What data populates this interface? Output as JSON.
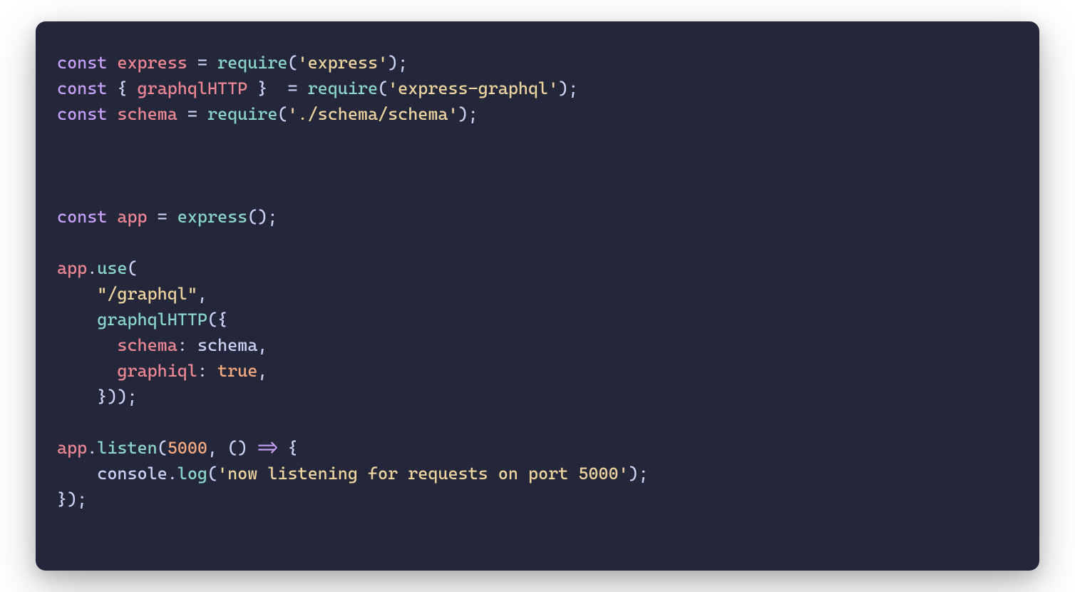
{
  "code": {
    "t1": "const",
    "t2": "express",
    "t3": "require",
    "t4": "'express'",
    "t5": "const",
    "t6": "graphqlHTTP",
    "t7": "require",
    "t8": "'express-graphql'",
    "t9": "const",
    "t10": "schema",
    "t11": "require",
    "t12": "'./schema/schema'",
    "t13": "const",
    "t14": "app",
    "t15": "express",
    "t16": "app",
    "t17": "use",
    "t18": "\"/graphql\"",
    "t19": "graphqlHTTP",
    "t20": "schema",
    "t21": "schema",
    "t22": "graphiql",
    "t23": "true",
    "t24": "app",
    "t25": "listen",
    "t26": "5000",
    "t27": "console",
    "t28": "log",
    "t29": "'now listening for requests on port 5000'",
    "p_eq": " = ",
    "p_op": "(",
    "p_cl": ")",
    "p_sc": ";",
    "p_cm": ",",
    "p_dt": ".",
    "p_cbo": "{",
    "p_cbc": "}",
    "p_ob": " { ",
    "p_cb": " } ",
    "p_col": ": ",
    "p_arrow": " => ",
    "p_nl": "\n",
    "p_ind1": "    ",
    "p_ind2": "      ",
    "p_clbr": "}));",
    "p_endfn": "});"
  }
}
